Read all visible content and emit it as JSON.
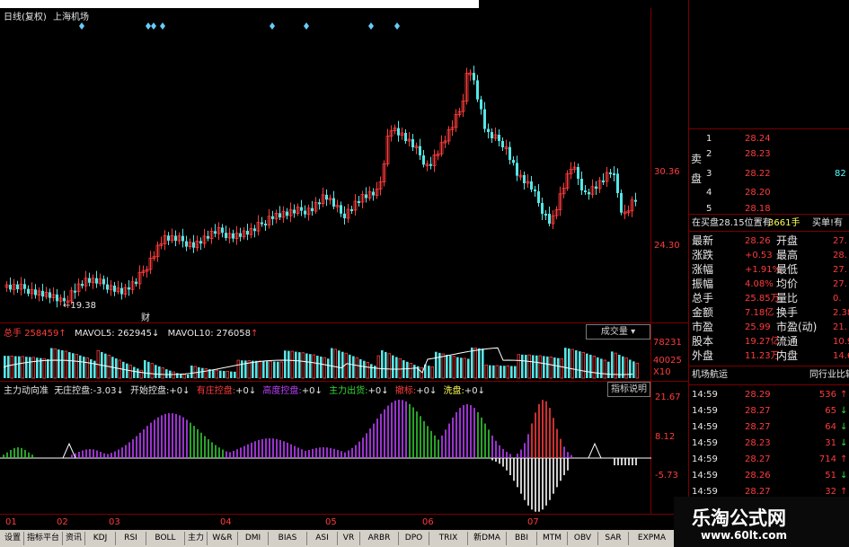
{
  "main": {
    "title_period": "日线(复权)",
    "title_stock": "上海机场",
    "price_labels": [
      "30.36",
      "24.30"
    ],
    "low_price": "19.38",
    "event_marker": "财",
    "top_mark": "—"
  },
  "volume": {
    "label_total": "总手",
    "total_value": "258459",
    "mavol5_label": "MAVOL5:",
    "mavol5_value": "262945",
    "mavol10_label": "MAVOL10:",
    "mavol10_value": "276058",
    "button": "成交量",
    "axis": [
      "78231",
      "40025",
      "X10"
    ]
  },
  "indicator": {
    "name": "主力动向准",
    "a_label": "无庄控盘:",
    "a_value": "-3.03",
    "b_label": "开始控盘:",
    "b_value": "+0",
    "c_label": "有庄控盘:",
    "c_value": "+0",
    "d_label": "高度控盘:",
    "d_value": "+0",
    "e_label": "主力出货:",
    "e_value": "+0",
    "f_label": "撤标:",
    "f_value": "+0",
    "g_label": "洗盘:",
    "g_value": "+0",
    "button": "指标说明",
    "axis": [
      "21.67",
      "8.12",
      "-5.73"
    ]
  },
  "months": [
    "01",
    "02",
    "03",
    "04",
    "05",
    "06",
    "07"
  ],
  "order_book": {
    "side_label_1": "卖",
    "side_label_2": "盘",
    "rows": [
      {
        "level": "1",
        "price": "28.24",
        "vol": ""
      },
      {
        "level": "2",
        "price": "28.23",
        "vol": ""
      },
      {
        "level": "3",
        "price": "28.22",
        "vol": "82"
      },
      {
        "level": "4",
        "price": "28.20",
        "vol": ""
      },
      {
        "level": "5",
        "price": "28.18",
        "vol": ""
      }
    ],
    "summary": {
      "a": "在买盘28.15位置有",
      "b": "3661手",
      "c": "买单!有"
    }
  },
  "quote": [
    {
      "l1": "最新",
      "v1": "28.26",
      "l2": "开盘",
      "v2": "27."
    },
    {
      "l1": "涨跌",
      "v1": "+0.53",
      "l2": "最高",
      "v2": "28."
    },
    {
      "l1": "涨幅",
      "v1": "+1.91%",
      "l2": "最低",
      "v2": "27."
    },
    {
      "l1": "振幅",
      "v1": "4.08%",
      "l2": "均价",
      "v2": "27."
    },
    {
      "l1": "总手",
      "v1": "25.85万",
      "l2": "量比",
      "v2": "0."
    },
    {
      "l1": "金额",
      "v1": "7.18亿",
      "l2": "换手",
      "v2": "2.38"
    },
    {
      "l1": "市盈",
      "v1": "25.99",
      "l2": "市盈(动)",
      "v2": "21."
    },
    {
      "l1": "股本",
      "v1": "19.27亿",
      "l2": "流通",
      "v2": "10.93"
    },
    {
      "l1": "外盘",
      "v1": "11.23万",
      "l2": "内盘",
      "v2": "14.61"
    }
  ],
  "ticks_header": {
    "left": "机场航运",
    "right": "同行业比较"
  },
  "ticks": [
    {
      "time": "14:59",
      "price": "28.29",
      "vol": "536",
      "dir": "up"
    },
    {
      "time": "14:59",
      "price": "28.27",
      "vol": "65",
      "dir": "down"
    },
    {
      "time": "14:59",
      "price": "28.27",
      "vol": "64",
      "dir": "down"
    },
    {
      "time": "14:59",
      "price": "28.23",
      "vol": "31",
      "dir": "down"
    },
    {
      "time": "14:59",
      "price": "28.27",
      "vol": "714",
      "dir": "up"
    },
    {
      "time": "14:59",
      "price": "28.26",
      "vol": "51",
      "dir": "down"
    },
    {
      "time": "14:59",
      "price": "28.27",
      "vol": "32",
      "dir": "up"
    }
  ],
  "tabs": [
    "设置",
    "指标平台",
    "资讯",
    "KDJ",
    "RSI",
    "BOLL",
    "主力",
    "W&R",
    "DMI",
    "BIAS",
    "ASI",
    "VR",
    "ARBR",
    "DPO",
    "TRIX",
    "新DMA",
    "BBI",
    "MTM",
    "OBV",
    "SAR",
    "EXPMA",
    "主力动向准"
  ],
  "watermark": {
    "line1": "乐淘公式网",
    "line2": "www.60lt.com"
  },
  "colors": {
    "up": "#ff3c3c",
    "down": "#55e6e6",
    "purple": "#c040ff",
    "green": "#33cc33",
    "white": "#ffffff",
    "panel_border": "#7a0000"
  }
}
